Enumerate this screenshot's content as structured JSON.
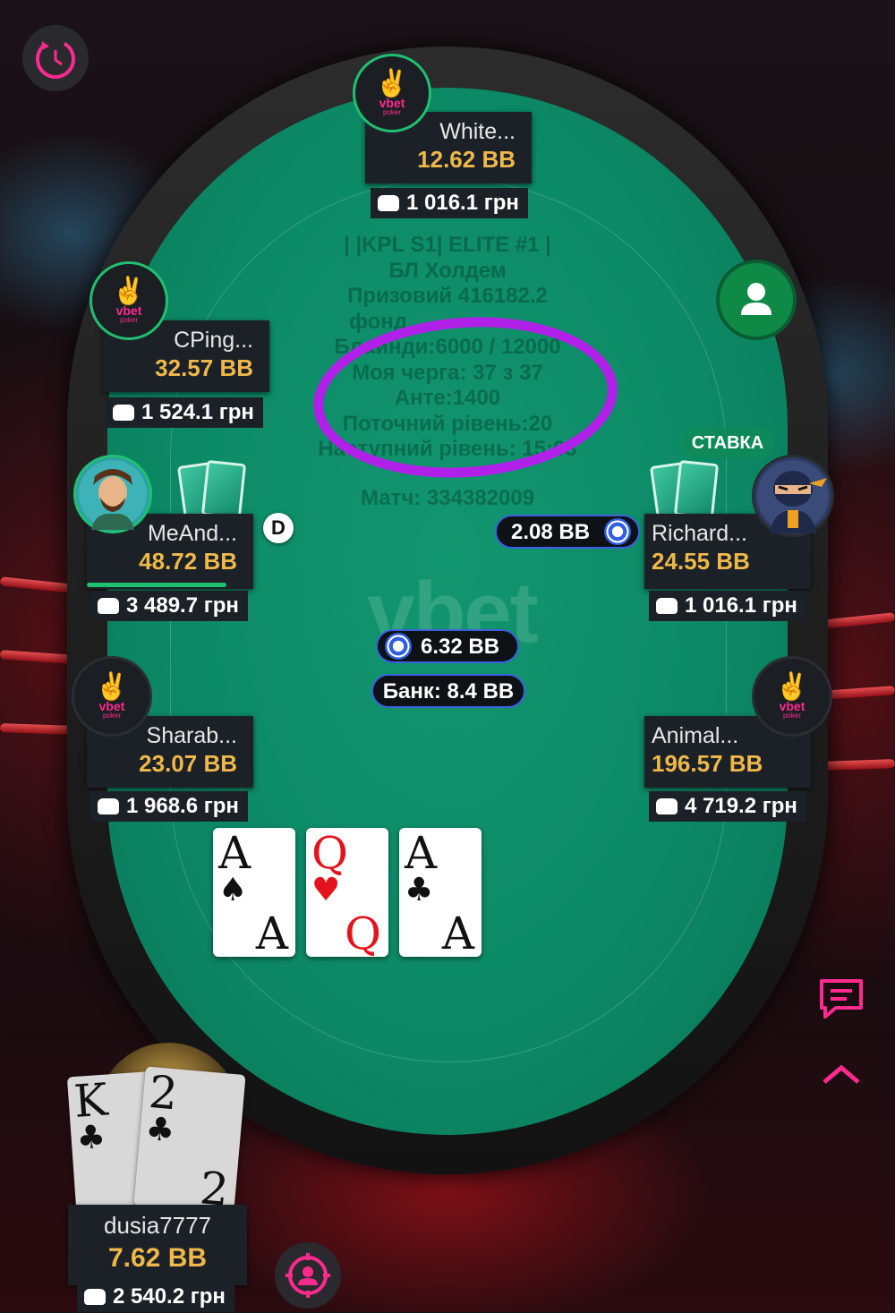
{
  "colors": {
    "accent": "#ff2a8e",
    "felt": "#0c8a66",
    "bb": "#f0b84a",
    "active": "#1fc070"
  },
  "table": {
    "info_lines": [
      "| |KPL S1| ELITE #1 |",
      "БЛ Холдем",
      "Призовий 416182.2",
      "фонд",
      "Блайнди:6000 / 12000",
      "Моя черга: 37 з 37",
      "Анте:1400",
      "Поточний рівень:20",
      "Наступний рівень: 15:03"
    ],
    "match": "Матч: 334382009",
    "logo": "vbet",
    "bet_center": "6.32 BB",
    "pot": "Банк: 8.4 BB",
    "dealer": "D"
  },
  "brand": {
    "sign": "✌",
    "word": "vbet",
    "sub": "poker"
  },
  "players": [
    {
      "name": "White...",
      "bb": "12.62 BB",
      "stack": "1 016.1 грн"
    },
    {
      "name": "CPing...",
      "bb": "32.57 BB",
      "stack": "1 524.1 грн"
    },
    {
      "name": "MeAnd...",
      "bb": "48.72 BB",
      "stack": "3 489.7 грн",
      "timer": 0.82
    },
    {
      "name": "Richard...",
      "bb": "24.55 BB",
      "stack": "1 016.1 грн",
      "bet": "2.08 BB",
      "action": "СТАВКА"
    },
    {
      "name": "Sharab...",
      "bb": "23.07 BB",
      "stack": "1 968.6 грн"
    },
    {
      "name": "Animal...",
      "bb": "196.57 BB",
      "stack": "4 719.2 грн"
    }
  ],
  "hero": {
    "name": "dusia7777",
    "bb": "7.62 BB",
    "stack": "2 540.2 грн",
    "cards": [
      {
        "rank": "K",
        "suit": "♣"
      },
      {
        "rank": "2",
        "suit": "♣"
      }
    ]
  },
  "board": [
    {
      "rank": "A",
      "suit": "♠",
      "color": "black"
    },
    {
      "rank": "Q",
      "suit": "♥",
      "color": "red"
    },
    {
      "rank": "A",
      "suit": "♣",
      "color": "black"
    }
  ],
  "icons": [
    "replay-icon",
    "user-seat-icon",
    "chat-icon",
    "chevron-up-icon",
    "target-user-icon"
  ]
}
